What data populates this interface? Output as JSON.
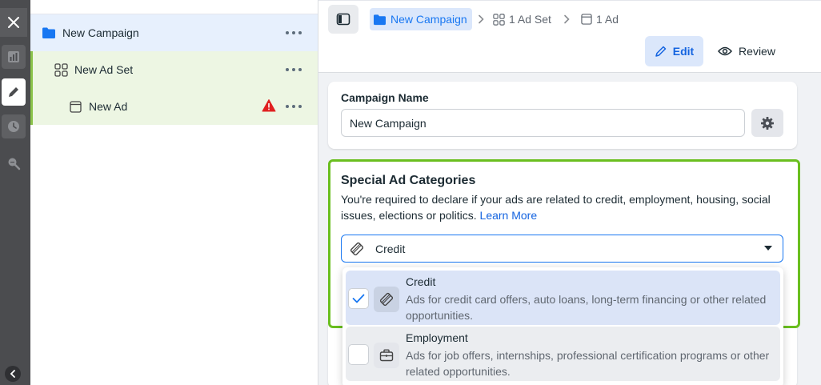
{
  "rail": {
    "items": [
      "close-icon",
      "bar-chart-icon",
      "pencil-icon",
      "clock-icon",
      "search-zoom-icon",
      "chevron-left-icon"
    ]
  },
  "tree": {
    "campaign": "New Campaign",
    "adset": "New Ad Set",
    "ad": "New Ad"
  },
  "breadcrumb": {
    "campaign": "New Campaign",
    "sep": ">",
    "adset": "1 Ad Set",
    "ad": "1 Ad"
  },
  "mode": {
    "edit": "Edit",
    "review": "Review"
  },
  "campaign_name": {
    "label": "Campaign Name",
    "value": "New Campaign"
  },
  "special_ad_categories": {
    "title": "Special Ad Categories",
    "description": "You're required to declare if your ads are related to credit, employment, housing, social issues, elections or politics.",
    "link": "Learn More",
    "selected": "Credit",
    "options": [
      {
        "title": "Credit",
        "description": "Ads for credit card offers, auto loans, long-term financing or other related opportunities.",
        "checked": true
      },
      {
        "title": "Employment",
        "description": "Ads for job offers, internships, professional certification programs or other related opportunities.",
        "checked": false
      }
    ]
  },
  "colors": {
    "accent": "#1877f2",
    "highlight_border": "#6abf1f",
    "rail": "#4b4c4f",
    "warning": "#e02020"
  }
}
